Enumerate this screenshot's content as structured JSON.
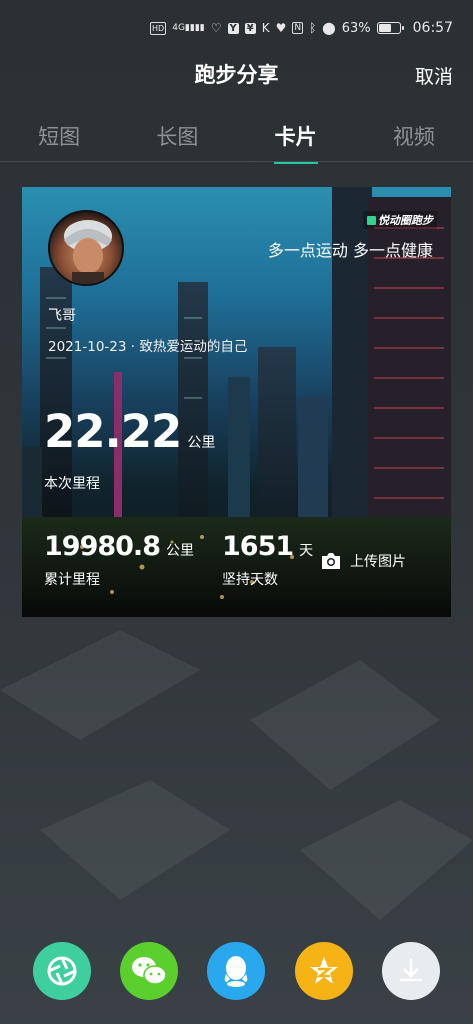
{
  "status_bar": {
    "hd_label": "HD",
    "signal_label": "4G",
    "battery_percent": "63%",
    "battery_level": 0.63,
    "time": "06:57"
  },
  "header": {
    "title": "跑步分享",
    "cancel_label": "取消"
  },
  "tabs": [
    {
      "label": "短图",
      "active": false
    },
    {
      "label": "长图",
      "active": false
    },
    {
      "label": "卡片",
      "active": true
    },
    {
      "label": "视频",
      "active": false
    }
  ],
  "card": {
    "brand": "悦动圈跑步",
    "slogan": "多一点运动 多一点健康",
    "nickname": "飞哥",
    "dateline": "2021-10-23 · 致热爱运动的自己",
    "distance": {
      "value": "22.22",
      "unit": "公里",
      "label": "本次里程"
    },
    "total_distance": {
      "value": "19980.8",
      "unit": "公里",
      "label": "累计里程"
    },
    "days": {
      "value": "1651",
      "unit": "天",
      "label": "坚持天数"
    },
    "upload_label": "上传图片"
  },
  "share_targets": [
    {
      "name": "camera-aperture-icon",
      "color": "#3fcf9f"
    },
    {
      "name": "wechat-icon",
      "color": "#5bcf2d"
    },
    {
      "name": "qq-icon",
      "color": "#2aa8ee"
    },
    {
      "name": "qzone-icon",
      "color": "#f5b316"
    },
    {
      "name": "download-icon",
      "color": "#e9ecee"
    }
  ],
  "colors": {
    "accent": "#1ec9a4",
    "tab_inactive": "#8d9296",
    "background": "#2e3438"
  }
}
